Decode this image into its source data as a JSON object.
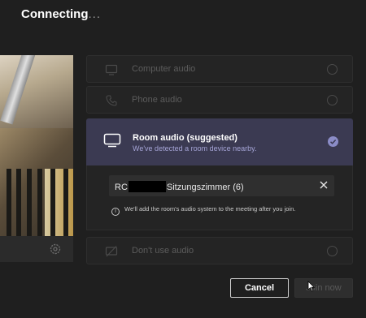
{
  "header": {
    "title": "Connecting",
    "dots": "..."
  },
  "audio_options": {
    "computer_audio": {
      "label": "Computer audio"
    },
    "phone_audio": {
      "label": "Phone audio"
    },
    "room_audio": {
      "label": "Room audio (suggested)",
      "subtitle": "We've detected a room device nearby.",
      "selected": true,
      "device_prefix": "RC",
      "device_suffix": "Sitzungszimmer (6)",
      "info": "We'll add the room's audio system to the meeting after you join."
    },
    "no_audio": {
      "label": "Don't use audio"
    }
  },
  "actions": {
    "cancel_label": "Cancel",
    "join_label": "Join now"
  },
  "colors": {
    "room_selected_bg": "#3b3a52",
    "room_subtitle": "#a5a4d6",
    "check": "#8b8cc7"
  },
  "icons": [
    "settings-icon",
    "computer-audio-icon",
    "phone-icon",
    "room-display-icon",
    "check-icon",
    "clear-icon",
    "info-icon",
    "no-audio-icon",
    "cursor-icon"
  ]
}
